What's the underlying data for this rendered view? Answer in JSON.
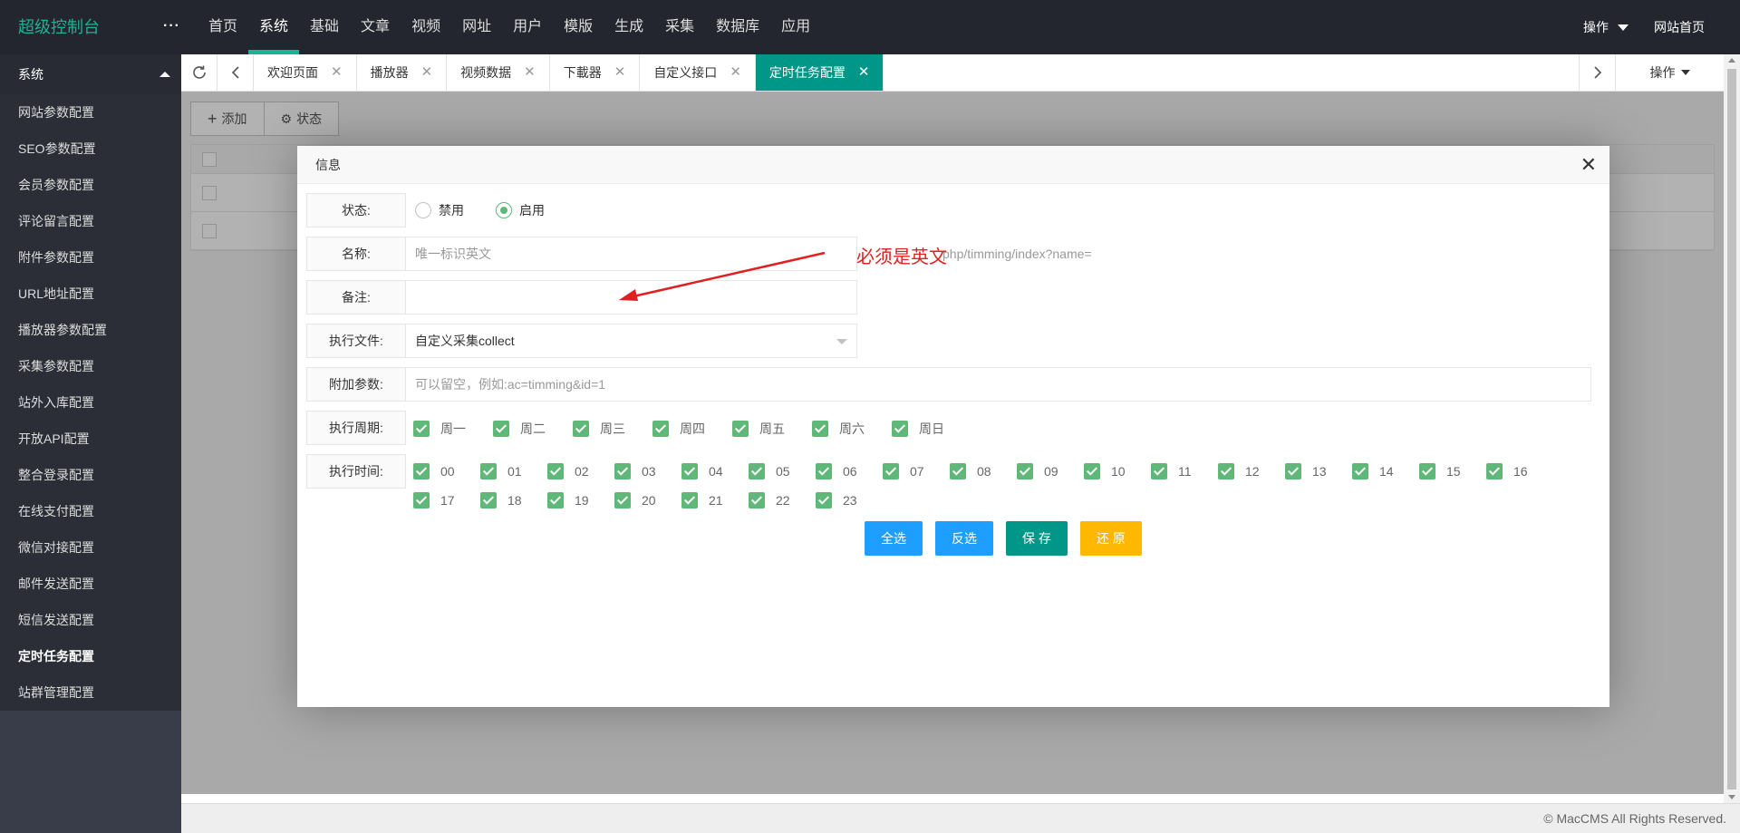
{
  "header": {
    "logo": "超级控制台",
    "more": "···",
    "nav": [
      "首页",
      "系统",
      "基础",
      "文章",
      "视频",
      "网址",
      "用户",
      "模版",
      "生成",
      "采集",
      "数据库",
      "应用"
    ],
    "ops_label": "操作",
    "home_label": "网站首页"
  },
  "sidebar": {
    "group": "系统",
    "items": [
      "网站参数配置",
      "SEO参数配置",
      "会员参数配置",
      "评论留言配置",
      "附件参数配置",
      "URL地址配置",
      "播放器参数配置",
      "采集参数配置",
      "站外入库配置",
      "开放API配置",
      "整合登录配置",
      "在线支付配置",
      "微信对接配置",
      "邮件发送配置",
      "短信发送配置",
      "定时任务配置",
      "站群管理配置"
    ]
  },
  "tabs": [
    "欢迎页面",
    "播放器",
    "视频数据",
    "下載器",
    "自定义接口",
    "定时任务配置"
  ],
  "tab_ops_label": "操作",
  "toolbar": {
    "add_label": "添加",
    "status_label": "状态"
  },
  "modal": {
    "title": "信息",
    "status_label": "状态:",
    "status_options": [
      "禁用",
      "启用"
    ],
    "name_label": "名称:",
    "name_placeholder": "唯一标识英文",
    "name_hint": "php/timming/index?name=",
    "remark_label": "备注:",
    "exec_file_label": "执行文件:",
    "exec_file_value": "自定义采集collect",
    "params_label": "附加参数:",
    "params_placeholder": "可以留空，例如:ac=timming&id=1",
    "cycle_label": "执行周期:",
    "weekdays": [
      "周一",
      "周二",
      "周三",
      "周四",
      "周五",
      "周六",
      "周日"
    ],
    "time_label": "执行时间:",
    "hours": [
      "00",
      "01",
      "02",
      "03",
      "04",
      "05",
      "06",
      "07",
      "08",
      "09",
      "10",
      "11",
      "12",
      "13",
      "14",
      "15",
      "16",
      "17",
      "18",
      "19",
      "20",
      "21",
      "22",
      "23"
    ],
    "buttons": {
      "select_all": "全选",
      "invert": "反选",
      "save": "保 存",
      "reset": "还 原"
    }
  },
  "annotation": "必须是英文",
  "footer": "© MacCMS All Rights Reserved."
}
